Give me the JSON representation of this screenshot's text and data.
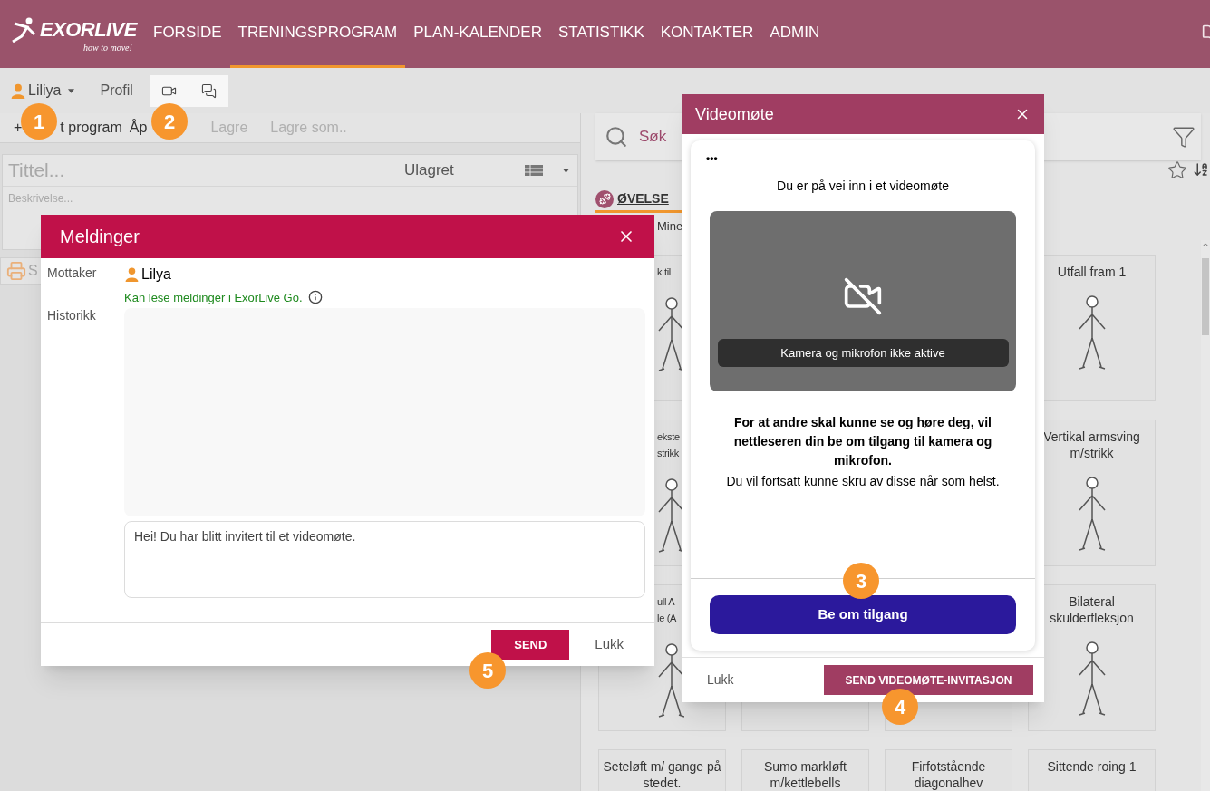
{
  "header": {
    "logo": "EXORLIVE",
    "tagline": "how to move!",
    "nav": [
      {
        "label": "FORSIDE",
        "selected": false
      },
      {
        "label": "TRENINGSPROGRAM",
        "selected": true
      },
      {
        "label": "PLAN-KALENDER",
        "selected": false
      },
      {
        "label": "STATISTIKK",
        "selected": false
      },
      {
        "label": "KONTAKTER",
        "selected": false
      },
      {
        "label": "ADMIN",
        "selected": false
      }
    ]
  },
  "toolbar": {
    "user": "Liliya",
    "profile": "Profil",
    "icon_tabs": [
      {
        "kind": "video"
      },
      {
        "kind": "chat"
      }
    ]
  },
  "program_bar": {
    "items": [
      {
        "label": "+",
        "disabled": false
      },
      {
        "label": "t program",
        "disabled": false
      },
      {
        "label": "Åp",
        "disabled": false
      },
      {
        "label": "Lagre",
        "disabled": true
      },
      {
        "label": "Lagre som..",
        "disabled": true
      }
    ]
  },
  "program": {
    "title_placeholder": "Tittel...",
    "status": "Ulagret",
    "description_placeholder": "Beskrivelse...",
    "print_label": "S"
  },
  "exercises": {
    "search_placeholder": "Søk",
    "tab": "ØVELSE",
    "subtab": "Mine",
    "cards": [
      {
        "kind": "partial",
        "lines": [
          "k til"
        ],
        "drawing": true
      },
      {
        "kind": "covered"
      },
      {
        "kind": "covered"
      },
      {
        "kind": "full",
        "title": "Utfall fram 1",
        "drawing": true
      },
      {
        "kind": "partial",
        "lines": [
          "ekste",
          "strikk"
        ],
        "drawing": true
      },
      {
        "kind": "covered"
      },
      {
        "kind": "covered"
      },
      {
        "kind": "full",
        "title": "Vertikal armsving m/strikk",
        "drawing": true
      },
      {
        "kind": "partial",
        "lines": [
          "ull A",
          "le (A"
        ],
        "drawing": true
      },
      {
        "kind": "blank"
      },
      {
        "kind": "blank"
      },
      {
        "kind": "full",
        "title": "Bilateral skulderfleksjon",
        "drawing": true
      },
      {
        "kind": "full",
        "title": "Seteløft m/ gange på stedet.",
        "drawing": false
      },
      {
        "kind": "full",
        "title": "Sumo markløft m/kettlebells",
        "drawing": false
      },
      {
        "kind": "full",
        "title": "Firfotstående diagonalhev",
        "drawing": false
      },
      {
        "kind": "full",
        "title": "Sittende roing 1",
        "drawing": false
      }
    ]
  },
  "messages_dialog": {
    "title": "Meldinger",
    "recipient_label": "Mottaker",
    "recipient": "Lilya",
    "note": "Kan lese meldinger i ExorLive Go.",
    "history_label": "Historikk",
    "message": "Hei! Du har blitt invitert til et videomøte.",
    "send": "SEND",
    "close": "Lukk"
  },
  "video_dialog": {
    "title": "Videomøte",
    "menu": "•••",
    "heading": "Du er på vei inn i et videomøte",
    "camera_status": "Kamera og mikrofon ikke aktive",
    "explanation": "For at andre skal kunne se og høre deg, vil nettleseren din be om tilgang til kamera og mikrofon.",
    "note": "Du vil fortsatt kunne skru av disse når som helst.",
    "request": "Be om tilgang",
    "close": "Lukk",
    "invite": "SEND VIDEOMØTE-INVITASJON"
  },
  "markers": [
    "1",
    "2",
    "3",
    "4",
    "5"
  ]
}
